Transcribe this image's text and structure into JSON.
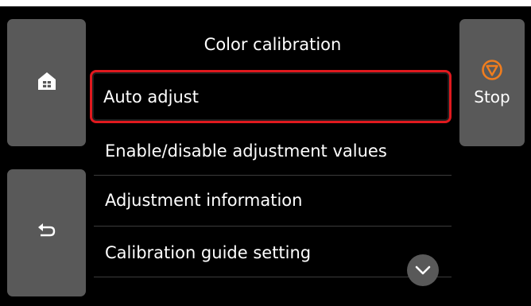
{
  "screen": {
    "title": "Color calibration"
  },
  "side_buttons": {
    "home_icon": "home-icon",
    "back_icon": "return-arrow-icon",
    "stop_icon": "stop-icon",
    "stop_label": "Stop"
  },
  "menu": {
    "items": [
      {
        "label": "Auto adjust",
        "selected": true
      },
      {
        "label": "Enable/disable adjustment values",
        "selected": false
      },
      {
        "label": "Adjustment information",
        "selected": false
      },
      {
        "label": "Calibration guide setting",
        "selected": false
      }
    ],
    "scroll_icon": "chevron-down-icon"
  },
  "colors": {
    "background": "#000000",
    "button": "#595959",
    "selection_border": "#e0191e",
    "stop_accent": "#f07d1e",
    "text": "#ffffff"
  }
}
